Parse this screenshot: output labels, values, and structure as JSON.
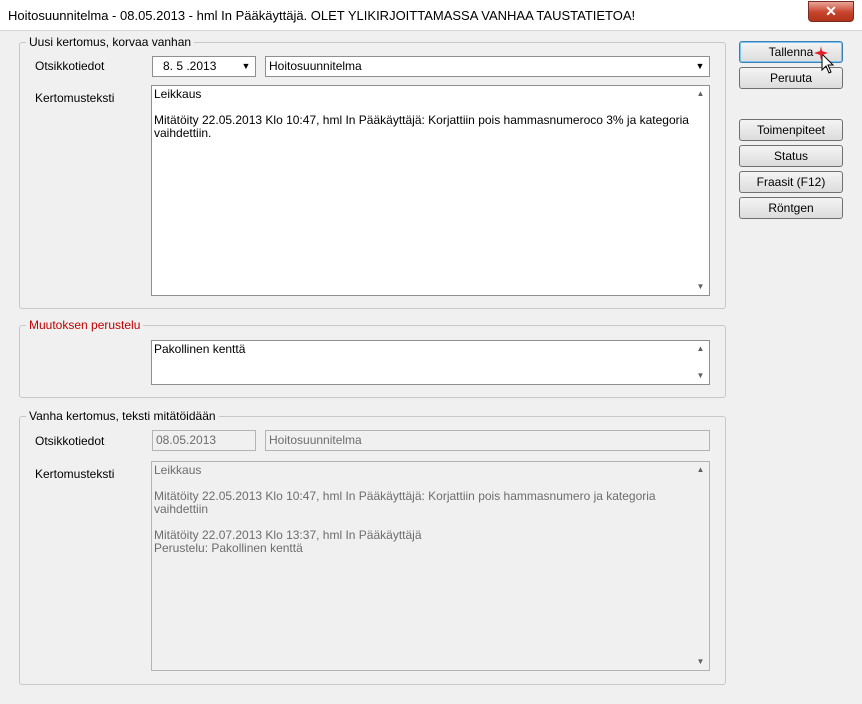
{
  "window": {
    "title": "Hoitosuunnitelma  -  08.05.2013  -  hml In Pääkäyttäjä. OLET YLIKIRJOITTAMASSA VANHAA TAUSTATIETOA!",
    "close_label": "✕"
  },
  "new_entry": {
    "legend": "Uusi kertomus, korvaa vanhan",
    "header_label": "Otsikkotiedot",
    "date_value": "8. 5 .2013",
    "type_value": "Hoitosuunnitelma",
    "text_label": "Kertomusteksti",
    "text_value": "Leikkaus\n\nMitätöity 22.05.2013 Klo 10:47, hml In Pääkäyttäjä: Korjattiin pois hammasnumeroco 3% ja kategoria vaihdettiin."
  },
  "reason": {
    "legend": "Muutoksen perustelu",
    "text_value": "Pakollinen kenttä"
  },
  "old_entry": {
    "legend": "Vanha kertomus, teksti mitätöidään",
    "header_label": "Otsikkotiedot",
    "date_value": "08.05.2013",
    "type_value": "Hoitosuunnitelma",
    "text_label": "Kertomusteksti",
    "text_value": "Leikkaus\n\nMitätöity 22.05.2013 Klo 10:47, hml In Pääkäyttäjä: Korjattiin pois hammasnumero ja kategoria vaihdettiin\n\nMitätöity 22.07.2013 Klo 13:37, hml In Pääkäyttäjä\nPerustelu: Pakollinen kenttä"
  },
  "buttons": {
    "save": "Tallenna",
    "cancel": "Peruuta",
    "actions": "Toimenpiteet",
    "status": "Status",
    "phrases": "Fraasit (F12)",
    "xray": "Röntgen"
  },
  "icons": {
    "scroll_up": "▲",
    "scroll_down": "▼",
    "dropdown": "▼"
  }
}
